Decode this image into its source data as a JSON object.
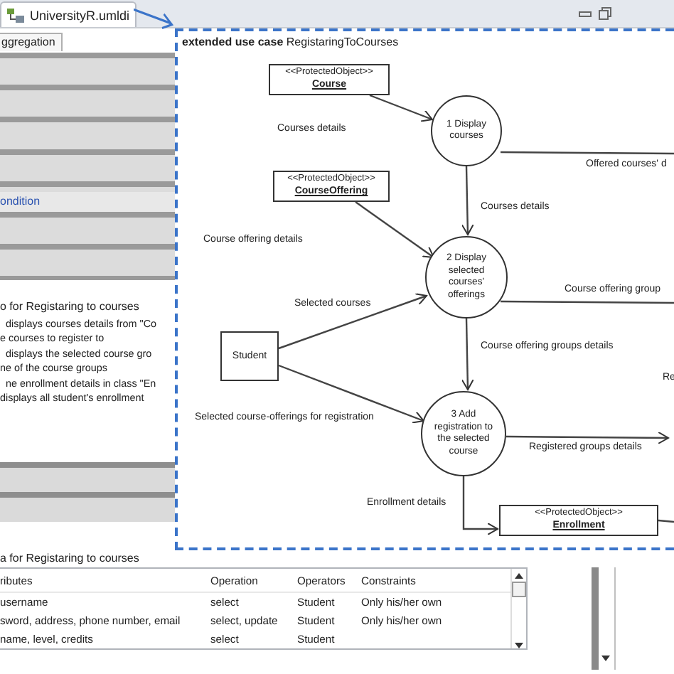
{
  "editor_tab": {
    "title": "UniversityR.umldi"
  },
  "left_panel": {
    "tab": "ggregation",
    "link": "ondition",
    "section_title": "o for Registaring to courses",
    "steps": [
      "displays courses details from \"Co",
      "e courses to register to",
      "displays the selected course gro",
      "ne of the course groups",
      "ne enrollment details in class \"En",
      "displays all student's enrollment"
    ],
    "table_title": "a for Registaring to courses"
  },
  "table": {
    "columns": [
      "ributes",
      "Operation",
      "Operators",
      "Constraints"
    ],
    "rows": [
      {
        "cells": [
          "username",
          "select",
          "Student",
          "Only his/her own"
        ]
      },
      {
        "cells": [
          "sword, address, phone number, email",
          "select, update",
          "Student",
          "Only his/her own"
        ]
      },
      {
        "cells": [
          "name, level, credits",
          "select",
          "Student"
        ]
      }
    ]
  },
  "diagram": {
    "kind_label": "extended use case",
    "name": "RegistaringToCourses",
    "nodes": [
      {
        "kind": "store",
        "stereotype": "<<ProtectedObject>>",
        "name": "Course"
      },
      {
        "kind": "process",
        "label": "1 Display courses"
      },
      {
        "kind": "store",
        "stereotype": "<<ProtectedObject>>",
        "name": "CourseOffering"
      },
      {
        "kind": "process",
        "label": "2 Display selected courses' offerings"
      },
      {
        "kind": "entity",
        "label": "Student"
      },
      {
        "kind": "process",
        "label": "3 Add registration to the selected course"
      },
      {
        "kind": "store",
        "stereotype": "<<ProtectedObject>>",
        "name": "Enrollment"
      }
    ],
    "flows": [
      {
        "label": "Courses details",
        "arrow": true
      },
      {
        "label": "Offered courses' d",
        "arrow": false
      },
      {
        "label": "Courses details",
        "arrow": true
      },
      {
        "label": "Course offering details",
        "arrow": true
      },
      {
        "label": "Course offering group",
        "arrow": false
      },
      {
        "label": "Selected courses",
        "arrow": true
      },
      {
        "label": "Course offering groups details",
        "arrow": true
      },
      {
        "label": "Re"
      },
      {
        "label": "Selected course-offerings for registration",
        "arrow": true
      },
      {
        "label": "Registered groups details",
        "arrow": true
      },
      {
        "label": "Enrollment details",
        "arrow": true
      },
      {
        "arrow": false
      }
    ]
  }
}
